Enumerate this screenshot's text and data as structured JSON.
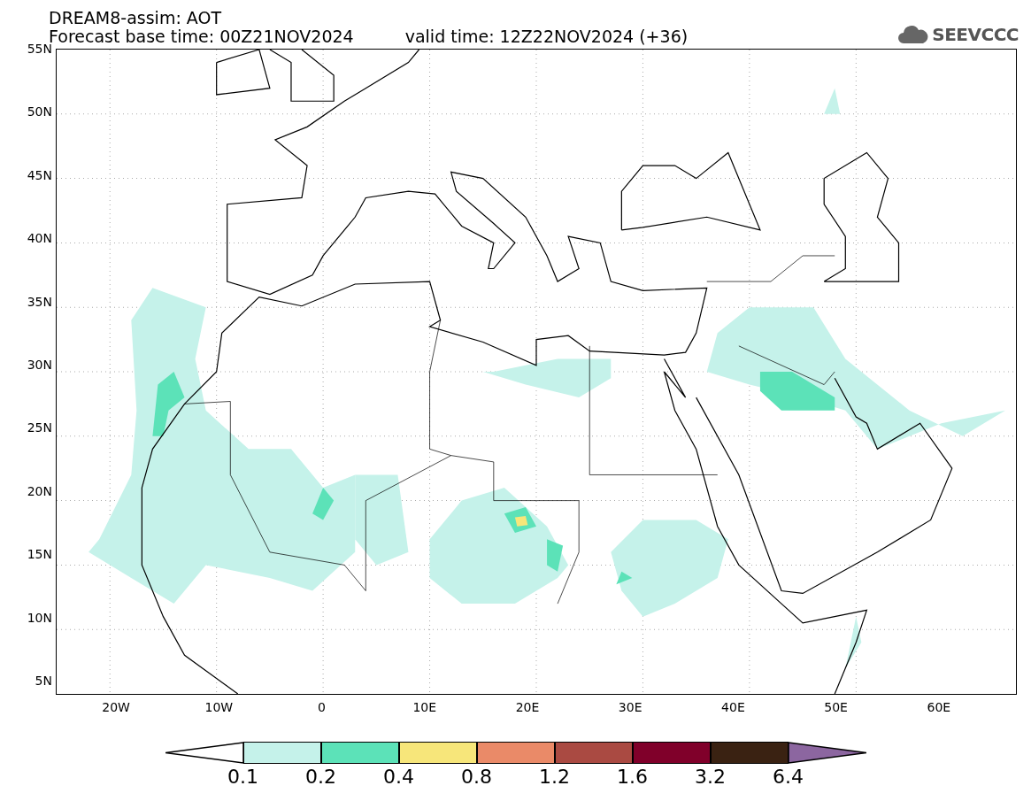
{
  "header": {
    "title": "DREAM8-assim: AOT",
    "base_time": "Forecast base time: 00Z21NOV2024",
    "valid_time": "valid time: 12Z22NOV2024 (+36)"
  },
  "logo": {
    "text": "SEEVCCC"
  },
  "map": {
    "lat_labels": [
      "55N",
      "50N",
      "45N",
      "40N",
      "35N",
      "30N",
      "25N",
      "20N",
      "15N",
      "10N",
      "5N"
    ],
    "lon_labels": [
      "20W",
      "10W",
      "0",
      "10E",
      "20E",
      "30E",
      "40E",
      "50E",
      "60E"
    ]
  },
  "colorbar": {
    "segments": [
      {
        "kind": "arrow",
        "color": "#ffffff"
      },
      {
        "kind": "box",
        "color": "#c5f2ea"
      },
      {
        "kind": "box",
        "color": "#5ce2b8"
      },
      {
        "kind": "box",
        "color": "#f7e67a"
      },
      {
        "kind": "box",
        "color": "#ea8a68"
      },
      {
        "kind": "box",
        "color": "#aa4a42"
      },
      {
        "kind": "box",
        "color": "#80002a"
      },
      {
        "kind": "box",
        "color": "#3a2212"
      },
      {
        "kind": "arrow",
        "color": "#8c66a0"
      }
    ],
    "labels": [
      "0.1",
      "0.2",
      "0.4",
      "0.8",
      "1.2",
      "1.6",
      "3.2",
      "6.4"
    ]
  }
}
